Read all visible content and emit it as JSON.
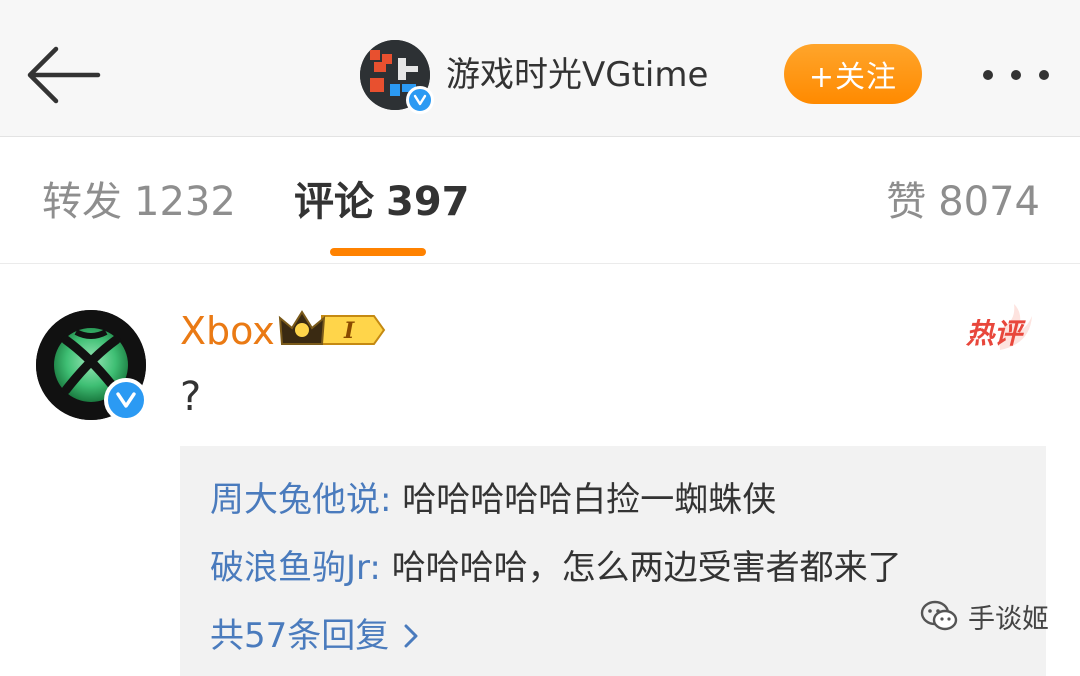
{
  "header": {
    "account_name": "游戏时光VGtime",
    "follow_label": "+关注"
  },
  "tabs": [
    {
      "label": "转发",
      "count": "1232",
      "active": false
    },
    {
      "label": "评论",
      "count": "397",
      "active": true
    },
    {
      "label": "赞",
      "count": "8074",
      "active": false
    }
  ],
  "comment": {
    "user": "Xbox",
    "vip_level": "I",
    "hot_label": "热评",
    "text": "?",
    "replies": [
      {
        "name": "周大兔他说",
        "text": "哈哈哈哈哈白捡一蜘蛛侠"
      },
      {
        "name": "破浪鱼驹Jr",
        "text": "哈哈哈哈，怎么两边受害者都来了"
      }
    ],
    "more_replies": "共57条回复"
  },
  "watermark": "手谈姬",
  "colors": {
    "accent_orange": "#ff8200",
    "username_orange": "#ea7a14",
    "link_blue": "#4a7bbd",
    "verified_blue": "#2b9af3",
    "hot_red": "#e8473c"
  }
}
